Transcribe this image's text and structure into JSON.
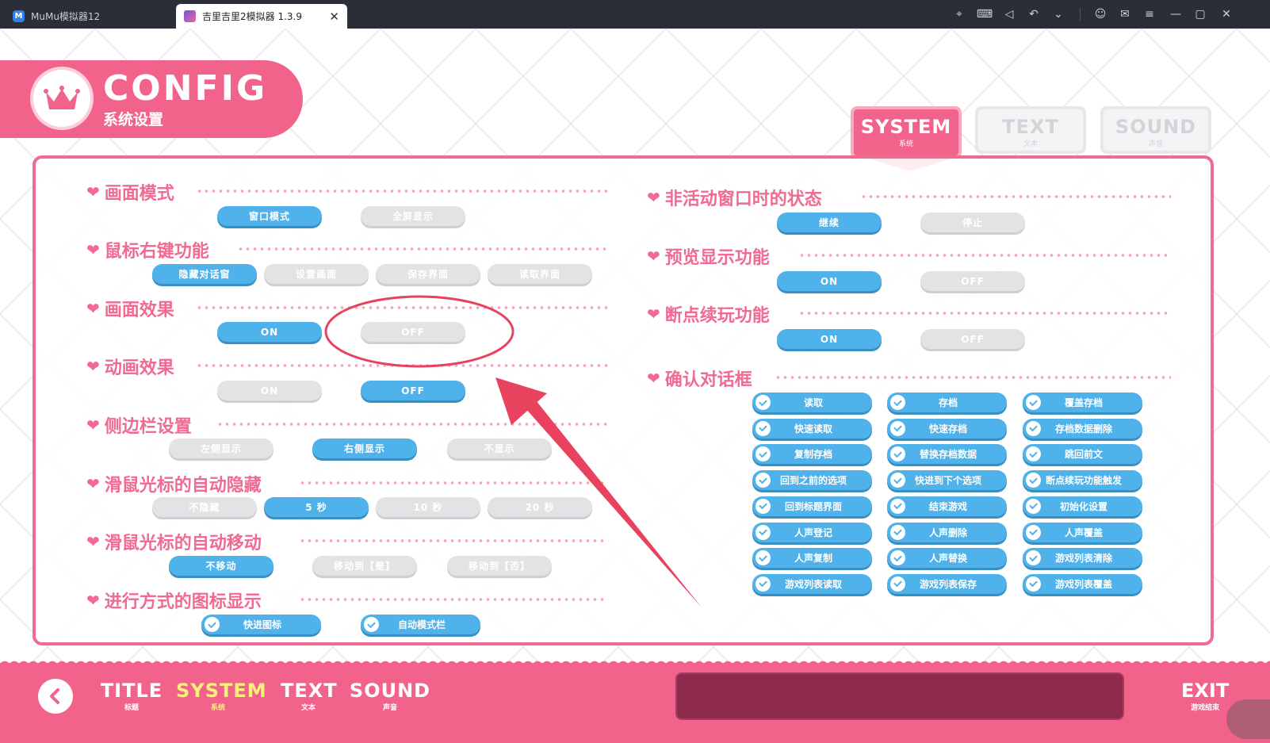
{
  "titlebar": {
    "tab_inactive": "MuMu模拟器12",
    "tab_active": "吉里吉里2模拟器 1.3.9",
    "close_glyph": "✕",
    "icons": [
      "pin-icon",
      "keyboard-icon",
      "volume-icon",
      "undo-icon",
      "chevron-down-icon",
      "user-icon",
      "mail-icon",
      "menu-icon",
      "minimize-icon",
      "maximize-icon",
      "close-icon"
    ]
  },
  "config": {
    "title": "CONFIG",
    "subtitle": "系统设置"
  },
  "tabs": [
    {
      "en": "SYSTEM",
      "cn": "系统",
      "active": true
    },
    {
      "en": "TEXT",
      "cn": "文本",
      "active": false
    },
    {
      "en": "SOUND",
      "cn": "声音",
      "active": false
    }
  ],
  "left": {
    "display_mode": {
      "title": "画面模式",
      "options": [
        "窗口模式",
        "全屏显示"
      ]
    },
    "right_click": {
      "title": "鼠标右键功能",
      "options": [
        "隐藏对话窗",
        "设置画面",
        "保存界面",
        "读取界面"
      ]
    },
    "screen_effect": {
      "title": "画面效果",
      "options": [
        "ON",
        "OFF"
      ]
    },
    "anim_effect": {
      "title": "动画效果",
      "options": [
        "ON",
        "OFF"
      ]
    },
    "sidebar": {
      "title": "侧边栏设置",
      "options": [
        "左侧显示",
        "右侧显示",
        "不显示"
      ]
    },
    "auto_hide": {
      "title": "滑鼠光标的自动隐藏",
      "options": [
        "不隐藏",
        "5 秒",
        "10 秒",
        "20 秒"
      ]
    },
    "auto_move": {
      "title": "滑鼠光标的自动移动",
      "options": [
        "不移动",
        "移动到【是】",
        "移动到【否】"
      ]
    },
    "progress_icons": {
      "title": "进行方式的图标显示",
      "options": [
        "快进图标",
        "自动模式栏"
      ]
    }
  },
  "right": {
    "inactive_state": {
      "title": "非活动窗口时的状态",
      "options": [
        "继续",
        "停止"
      ]
    },
    "preview": {
      "title": "预览显示功能",
      "options": [
        "ON",
        "OFF"
      ]
    },
    "resume": {
      "title": "断点续玩功能",
      "options": [
        "ON",
        "OFF"
      ]
    },
    "confirm": {
      "title": "确认对话框",
      "items": [
        "读取",
        "存档",
        "覆盖存档",
        "快速读取",
        "快速存档",
        "存档数据删除",
        "复制存档",
        "替换存档数据",
        "跳回前文",
        "回到之前的选项",
        "快进到下个选项",
        "断点续玩功能触发",
        "回到标题界面",
        "结束游戏",
        "初始化设置",
        "人声登记",
        "人声删除",
        "人声覆盖",
        "人声复制",
        "人声替换",
        "游戏列表清除",
        "游戏列表读取",
        "游戏列表保存",
        "游戏列表覆盖"
      ]
    }
  },
  "footer": {
    "nav": [
      {
        "en": "TITLE",
        "cn": "标题"
      },
      {
        "en": "SYSTEM",
        "cn": "系统"
      },
      {
        "en": "TEXT",
        "cn": "文本"
      },
      {
        "en": "SOUND",
        "cn": "声音"
      }
    ],
    "exit": {
      "en": "EXIT",
      "cn": "游戏结束"
    }
  },
  "colors": {
    "accent": "#f2638c",
    "selected": "#4fb2ea",
    "unselected": "#e3e3e6",
    "annotation": "#e8425f"
  }
}
